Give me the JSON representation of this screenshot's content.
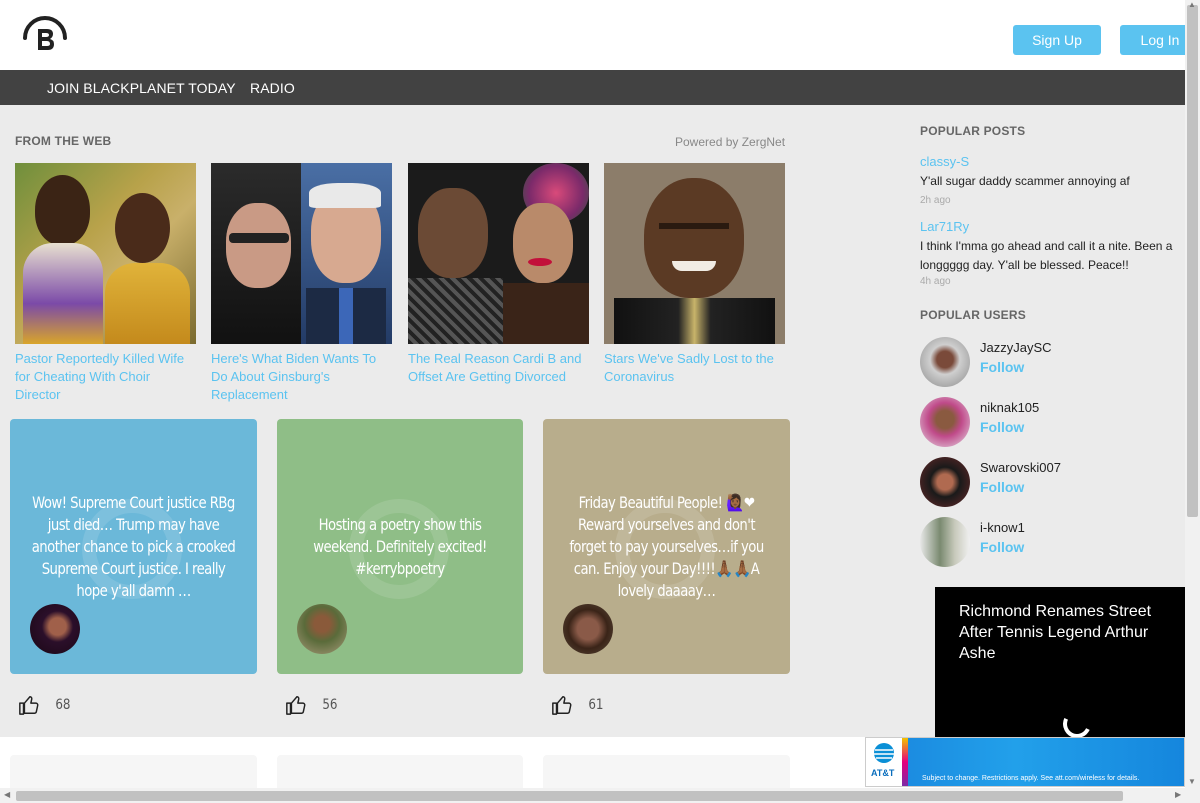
{
  "header": {
    "logo_icon": "blackplanet-logo-icon",
    "signup_label": "Sign Up",
    "login_label": "Log In"
  },
  "nav": {
    "items": [
      {
        "label": "JOIN BLACKPLANET TODAY"
      },
      {
        "label": "RADIO"
      }
    ]
  },
  "from_web": {
    "heading": "FROM THE WEB",
    "powered_by": "Powered by ZergNet",
    "cards": [
      {
        "title": "Pastor Reportedly Killed Wife for Cheating With Choir Director"
      },
      {
        "title": "Here's What Biden Wants To Do About Ginsburg's Replacement"
      },
      {
        "title": "The Real Reason Cardi B and Offset Are Getting Divorced"
      },
      {
        "title": "Stars We've Sadly Lost to the Coronavirus"
      }
    ]
  },
  "posts": [
    {
      "text": "Wow! Supreme Court justice RBg just died… Trump may have another chance to pick a crooked Supreme Court justice. I really hope y'all damn …",
      "likes": "68",
      "color": "#6bb8d9"
    },
    {
      "text": "Hosting a poetry show this weekend. Definitely excited! #kerrybpoetry",
      "likes": "56",
      "color": "#8fbe87"
    },
    {
      "text": "Friday Beautiful People! 🙋🏾‍♀️❤ Reward yourselves and don't forget to pay yourselves…if you can. Enjoy your Day!!!!🙏🏾🙏🏾A lovely daaaay…",
      "likes": "61",
      "color": "#b8ad8c"
    }
  ],
  "popular_posts": {
    "heading": "POPULAR POSTS",
    "items": [
      {
        "user": "classy-S",
        "text": "Y'all sugar daddy scammer annoying af",
        "time": "2h ago"
      },
      {
        "user": "Lar71Ry",
        "text": "I think I'mma go ahead and call it a nite. Been a longgggg day. Y'all be blessed. Peace!!",
        "time": "4h ago"
      }
    ]
  },
  "popular_users": {
    "heading": "POPULAR USERS",
    "follow_label": "Follow",
    "items": [
      {
        "name": "JazzyJaySC"
      },
      {
        "name": "niknak105"
      },
      {
        "name": "Swarovski007"
      },
      {
        "name": "i-know1"
      }
    ]
  },
  "video_ad": {
    "title": "Richmond Renames Street After Tennis Legend Arthur Ashe"
  },
  "banner_ad": {
    "brand": "AT&T",
    "fine_print": "Subject to change. Restrictions apply. See att.com/wireless for details."
  },
  "colors": {
    "accent": "#5bc3f0",
    "nav_bg": "#424242",
    "page_bg": "#ebebeb"
  }
}
